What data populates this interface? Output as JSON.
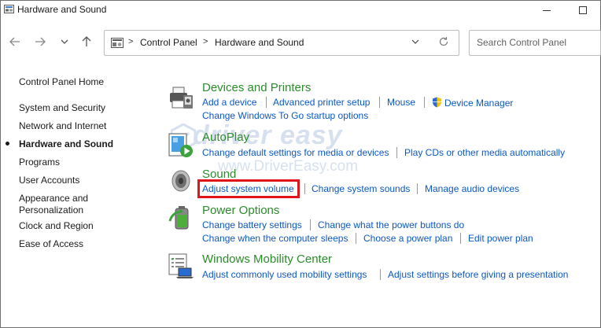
{
  "window": {
    "title": "Hardware and Sound"
  },
  "addressbar": {
    "crumbs": [
      "Control Panel",
      "Hardware and Sound"
    ]
  },
  "search": {
    "placeholder": "Search Control Panel"
  },
  "leftnav": {
    "home": "Control Panel Home",
    "items": [
      "System and Security",
      "Network and Internet",
      "Hardware and Sound",
      "Programs",
      "User Accounts",
      "Appearance and",
      "Personalization",
      "Clock and Region",
      "Ease of Access"
    ],
    "active": "Hardware and Sound"
  },
  "categories": {
    "devices": {
      "title": "Devices and Printers",
      "links": [
        "Add a device",
        "Advanced printer setup",
        "Mouse",
        "Device Manager",
        "Change Windows To Go startup options"
      ]
    },
    "autoplay": {
      "title": "AutoPlay",
      "links": [
        "Change default settings for media or devices",
        "Play CDs or other media automatically"
      ]
    },
    "sound": {
      "title": "Sound",
      "links": [
        "Adjust system volume",
        "Change system sounds",
        "Manage audio devices"
      ]
    },
    "power": {
      "title": "Power Options",
      "links": [
        "Change battery settings",
        "Change what the power buttons do",
        "Change when the computer sleeps",
        "Choose a power plan",
        "Edit power plan"
      ]
    },
    "mobility": {
      "title": "Windows Mobility Center",
      "links": [
        "Adjust commonly used mobility settings",
        "Adjust settings before giving a presentation"
      ]
    }
  },
  "watermark": {
    "logo_text": "driver easy",
    "url": "www.DriverEasy.com"
  },
  "colors": {
    "link": "#0b58c4",
    "category_title": "#2a8c2a",
    "highlight": "#e1141b"
  },
  "icons": [
    "control-panel-icon",
    "back-arrow-icon",
    "forward-arrow-icon",
    "recent-dropdown-icon",
    "up-arrow-icon",
    "folder-icon",
    "chevron-down-icon",
    "refresh-icon",
    "printer-icon",
    "autoplay-icon",
    "speaker-icon",
    "battery-icon",
    "mobility-icon",
    "shield-icon"
  ]
}
